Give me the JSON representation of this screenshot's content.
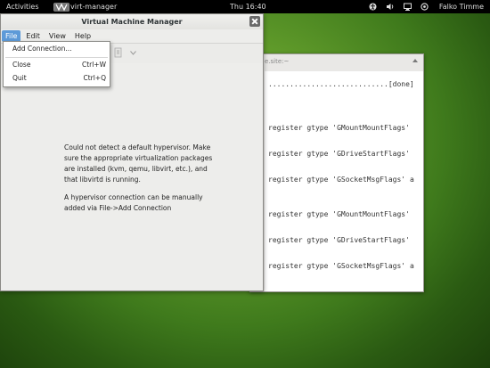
{
  "top_panel": {
    "activities": "Activities",
    "app_name": "virt-manager",
    "clock": "Thu 16:40",
    "user": "Falko Timme"
  },
  "background_window": {
    "title": "e.site:~",
    "lines": [
      "............................[done]",
      "register gtype 'GMountMountFlags'",
      "register gtype 'GDriveStartFlags'",
      "register gtype 'GSocketMsgFlags' a",
      "register gtype 'GMountMountFlags'",
      "register gtype 'GDriveStartFlags'",
      "register gtype 'GSocketMsgFlags' a"
    ]
  },
  "window": {
    "title": "Virtual Machine Manager"
  },
  "menubar": {
    "file": "File",
    "edit": "Edit",
    "view": "View",
    "help": "Help"
  },
  "file_menu": {
    "add_connection": "Add Connection...",
    "close": "Close",
    "close_shortcut": "Ctrl+W",
    "quit": "Quit",
    "quit_shortcut": "Ctrl+Q"
  },
  "content": {
    "message1": "Could not detect a default hypervisor. Make sure the appropriate virtualization packages are installed (kvm, qemu, libvirt, etc.), and that libvirtd is running.",
    "message2": "A hypervisor connection can be manually added via File->Add Connection"
  },
  "colors": {
    "menu_highlight": "#5d9ad8",
    "desktop_green": "#5f9a2a"
  },
  "icons": [
    "virt-manager-app-icon",
    "accessibility-icon",
    "volume-icon",
    "network-icon",
    "chat-icon",
    "close-icon",
    "chevron-down-icon"
  ]
}
